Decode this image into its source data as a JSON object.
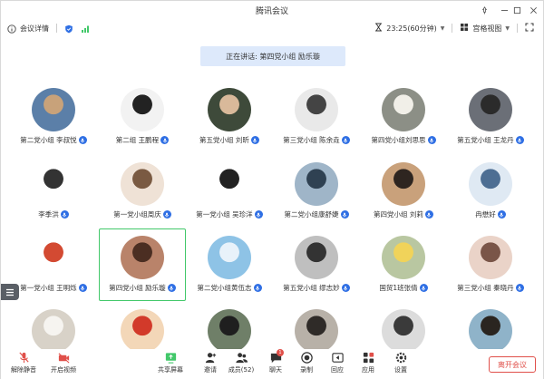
{
  "window": {
    "title": "腾讯会议"
  },
  "info": {
    "details_label": "会议详情",
    "timer": "23:25(60分钟)",
    "view_label": "宫格视图"
  },
  "banner": {
    "text": "正在讲话: 第四党小组 励乐璇"
  },
  "participants": [
    {
      "name": "第二党小组 李叔悦",
      "mic": true,
      "avatar": "cartoon-girls"
    },
    {
      "name": "第二组 王鹏程",
      "mic": true,
      "avatar": "cartoon-cat"
    },
    {
      "name": "第五党小组 刘昕",
      "mic": true,
      "avatar": "cartoon-boy"
    },
    {
      "name": "第三党小组 陈余垚",
      "mic": true,
      "avatar": "bw-art"
    },
    {
      "name": "第四党小组刘思思",
      "mic": true,
      "avatar": "dog-photo"
    },
    {
      "name": "第五党小组 王龙丹",
      "mic": true,
      "avatar": "cat-photo"
    },
    {
      "name": "李季洪",
      "mic": true,
      "avatar": "sketch-figure"
    },
    {
      "name": "第一党小组周庆",
      "mic": true,
      "avatar": "cartoon-woman"
    },
    {
      "name": "第一党小组 吴珍洋",
      "mic": true,
      "avatar": "bunny-sketch"
    },
    {
      "name": "第二党小组康舒婕",
      "mic": true,
      "avatar": "moon-scene"
    },
    {
      "name": "第四党小组 刘莉",
      "mic": true,
      "avatar": "girl-photo"
    },
    {
      "name": "冉懋好",
      "mic": true,
      "avatar": "blue-anime"
    },
    {
      "name": "第一党小组 王明烁",
      "mic": true,
      "avatar": "wow-cartoon"
    },
    {
      "name": "第四党小组 励乐璇",
      "mic": true,
      "avatar": "child-photo"
    },
    {
      "name": "第二党小组黄伍志",
      "mic": true,
      "avatar": "sky-photo"
    },
    {
      "name": "第五党小组 缪志妙",
      "mic": true,
      "avatar": "bw-couple"
    },
    {
      "name": "国贸1班张倩",
      "mic": true,
      "avatar": "flower-photo"
    },
    {
      "name": "第三党小组 秦晓丹",
      "mic": true,
      "avatar": "woman-photo"
    },
    {
      "name": "",
      "mic": false,
      "avatar": "white-dog"
    },
    {
      "name": "",
      "mic": false,
      "avatar": "crayon-shin"
    },
    {
      "name": "",
      "mic": false,
      "avatar": "longhair-photo"
    },
    {
      "name": "",
      "mic": false,
      "avatar": "man-photo"
    },
    {
      "name": "",
      "mic": false,
      "avatar": "bw-girl"
    },
    {
      "name": "",
      "mic": false,
      "avatar": "boy-photo"
    }
  ],
  "toolbar": {
    "unmute": "解除静音",
    "video": "开启视频",
    "share": "共享屏幕",
    "invite": "邀请",
    "members": "成员(52)",
    "chat": "聊天",
    "record": "录制",
    "apps": "应用",
    "settings": "设置",
    "leave": "离开会议",
    "chat_badge": "1"
  },
  "colors": {
    "accent": "#2f6fe4",
    "danger": "#e0504a",
    "speaking": "#42c86a",
    "banner": "#dde9fb"
  }
}
